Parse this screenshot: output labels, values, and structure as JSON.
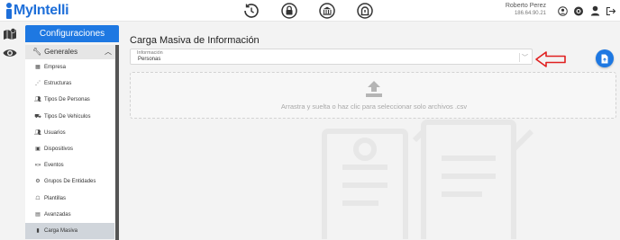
{
  "app": {
    "logo_text": "MyIntelli",
    "brand_color": "#1e6fd9"
  },
  "topbar": {
    "icons": [
      "clock-icon",
      "lock-icon",
      "bank-icon",
      "alert-icon"
    ],
    "user": {
      "name": "Roberto Perez",
      "ip": "186.64.90.21"
    },
    "user_icons": [
      "user-circle-icon",
      "record-icon",
      "profile-icon",
      "logout-icon"
    ]
  },
  "rail": {
    "icons": [
      "map-icon",
      "eye-icon"
    ]
  },
  "config": {
    "header": "Configuraciones",
    "group_label": "Generales",
    "items": [
      {
        "label": "Empresa",
        "icon": "building-icon"
      },
      {
        "label": "Estructuras",
        "icon": "structure-icon"
      },
      {
        "label": "Tipos De Personas",
        "icon": "people-icon"
      },
      {
        "label": "Tipos De Vehículos",
        "icon": "truck-icon"
      },
      {
        "label": "Usuarios",
        "icon": "users-icon"
      },
      {
        "label": "Dispositivos",
        "icon": "device-icon"
      },
      {
        "label": "Eventos",
        "icon": "events-icon"
      },
      {
        "label": "Grupos De Entidades",
        "icon": "cog-icon"
      },
      {
        "label": "Plantillas",
        "icon": "template-icon"
      },
      {
        "label": "Avanzadas",
        "icon": "advanced-icon"
      },
      {
        "label": "Carga Masiva",
        "icon": "file-icon",
        "active": true
      }
    ]
  },
  "main": {
    "title": "Carga Masiva de Información",
    "select": {
      "label": "Información",
      "value": "Personas"
    },
    "dropzone_text": "Arrastra y suelta o haz clic para seleccionar solo archivos .csv"
  },
  "colors": {
    "accent": "#1e78e2",
    "arrow": "#e02020"
  }
}
